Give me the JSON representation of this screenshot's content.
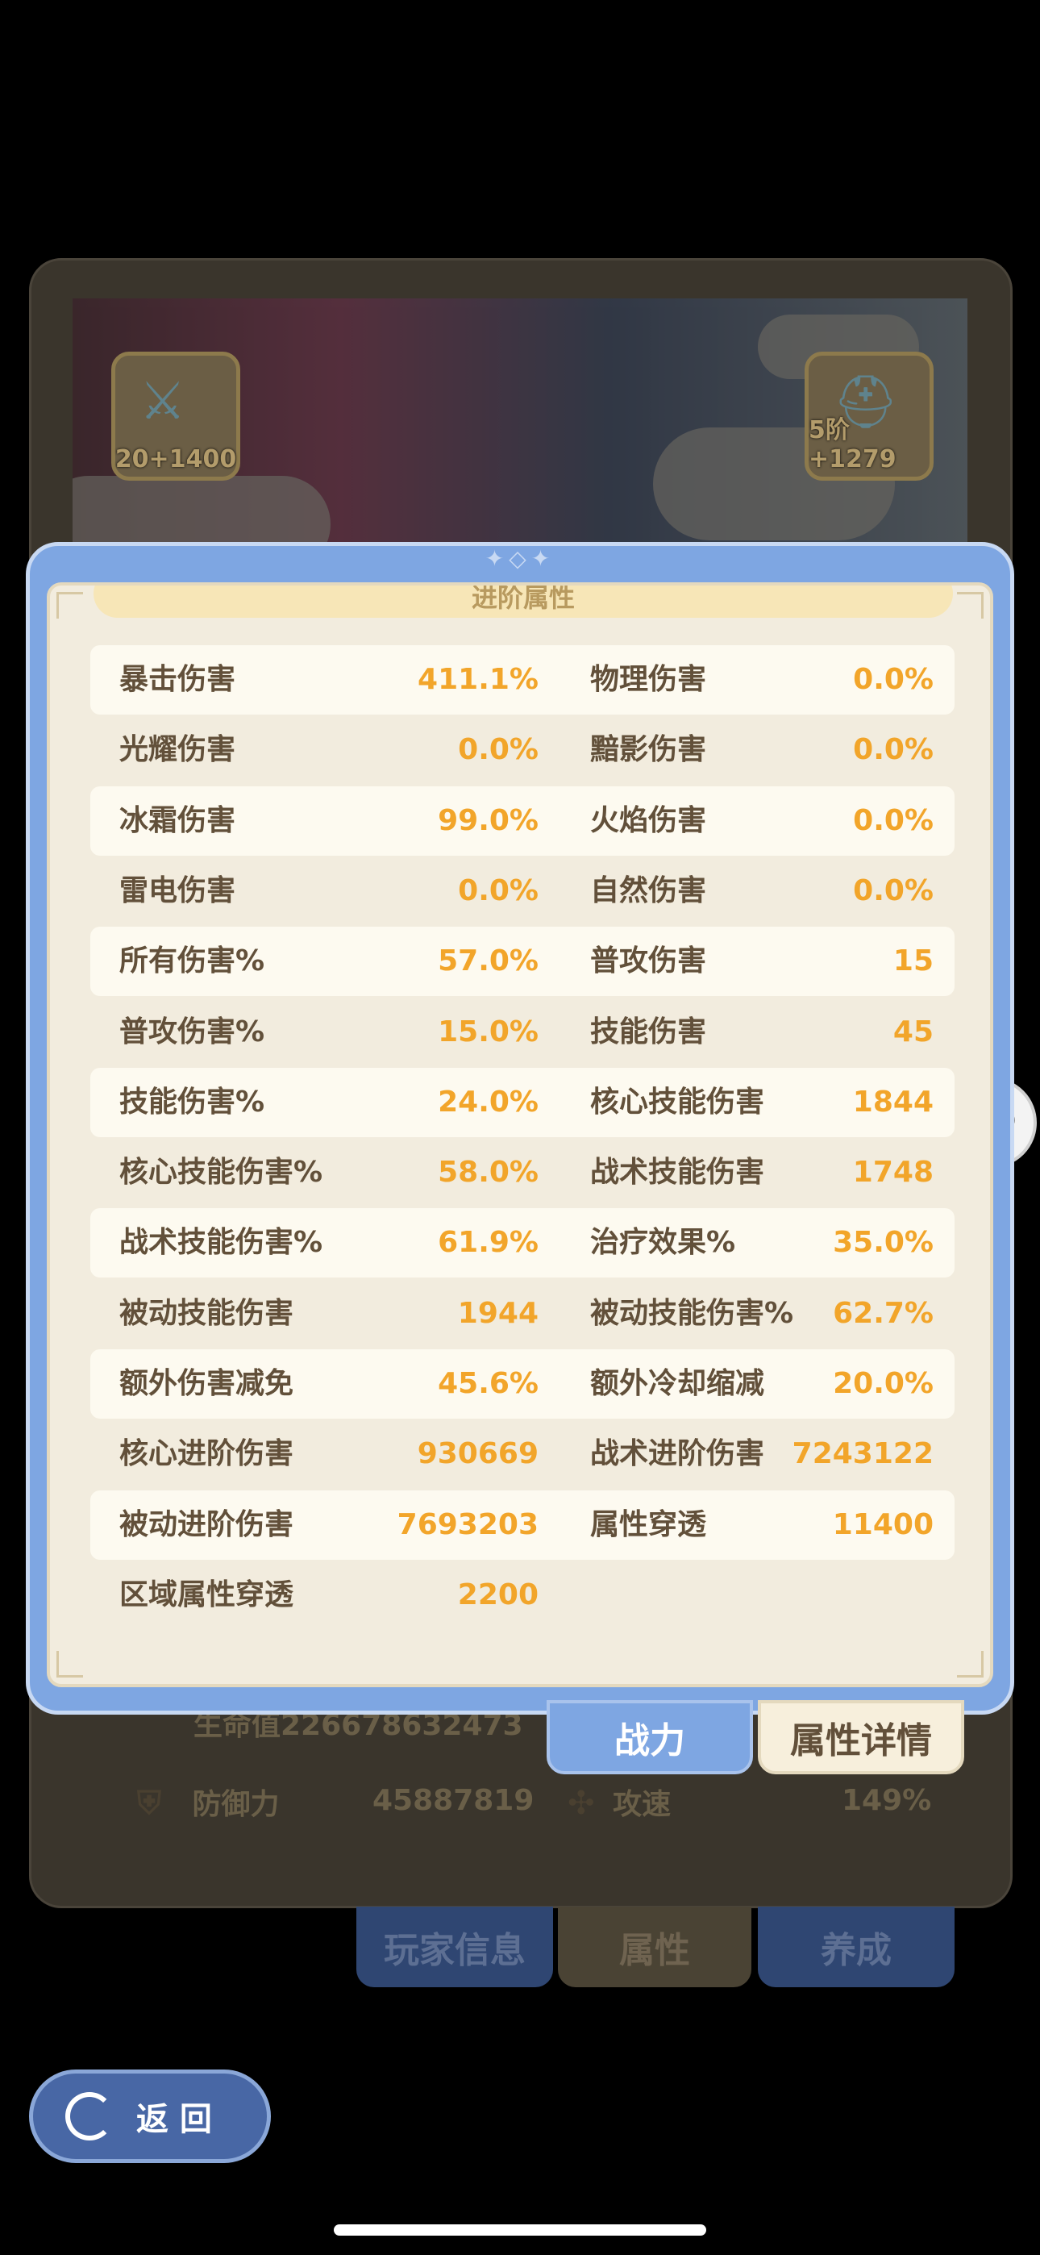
{
  "background": {
    "weapon_slot": "20+1400",
    "armor_slot": "5阶+1279",
    "hp_row": "生命值226678632473",
    "defense_label": "防御力",
    "defense_value": "45887819",
    "attack_speed_label": "攻速",
    "attack_speed_value": "149%",
    "bottom_tabs": [
      {
        "label": "玩家信息"
      },
      {
        "label": "属性"
      },
      {
        "label": "养成"
      }
    ],
    "back_button": "返 回"
  },
  "modal": {
    "section_title": "进阶属性",
    "rows": [
      {
        "left_label": "暴击伤害",
        "left_value": "411.1%",
        "right_label": "物理伤害",
        "right_value": "0.0%"
      },
      {
        "left_label": "光耀伤害",
        "left_value": "0.0%",
        "right_label": "黯影伤害",
        "right_value": "0.0%"
      },
      {
        "left_label": "冰霜伤害",
        "left_value": "99.0%",
        "right_label": "火焰伤害",
        "right_value": "0.0%"
      },
      {
        "left_label": "雷电伤害",
        "left_value": "0.0%",
        "right_label": "自然伤害",
        "right_value": "0.0%"
      },
      {
        "left_label": "所有伤害%",
        "left_value": "57.0%",
        "right_label": "普攻伤害",
        "right_value": "15"
      },
      {
        "left_label": "普攻伤害%",
        "left_value": "15.0%",
        "right_label": "技能伤害",
        "right_value": "45"
      },
      {
        "left_label": "技能伤害%",
        "left_value": "24.0%",
        "right_label": "核心技能伤害",
        "right_value": "1844"
      },
      {
        "left_label": "核心技能伤害%",
        "left_value": "58.0%",
        "right_label": "战术技能伤害",
        "right_value": "1748"
      },
      {
        "left_label": "战术技能伤害%",
        "left_value": "61.9%",
        "right_label": "治疗效果%",
        "right_value": "35.0%"
      },
      {
        "left_label": "被动技能伤害",
        "left_value": "1944",
        "right_label": "被动技能伤害%",
        "right_value": "62.7%"
      },
      {
        "left_label": "额外伤害减免",
        "left_value": "45.6%",
        "right_label": "额外冷却缩减",
        "right_value": "20.0%"
      },
      {
        "left_label": "核心进阶伤害",
        "left_value": "930669",
        "right_label": "战术进阶伤害",
        "right_value": "7243122"
      },
      {
        "left_label": "被动进阶伤害",
        "left_value": "7693203",
        "right_label": "属性穿透",
        "right_value": "11400"
      },
      {
        "left_label": "区域属性穿透",
        "left_value": "2200",
        "right_label": "",
        "right_value": ""
      }
    ],
    "tabs": [
      {
        "label": "战力"
      },
      {
        "label": "属性详情"
      }
    ]
  },
  "colors": {
    "modal_frame": "#7ea6e2",
    "panel_bg": "#f2ecde",
    "row_highlight": "#fdfaf0",
    "label": "#62503a",
    "value": "#f2a52a"
  },
  "icons": {
    "chat": "chat-bubble-icon",
    "back": "back-arrow-icon",
    "shield": "shield-icon",
    "speed": "speed-icon"
  }
}
